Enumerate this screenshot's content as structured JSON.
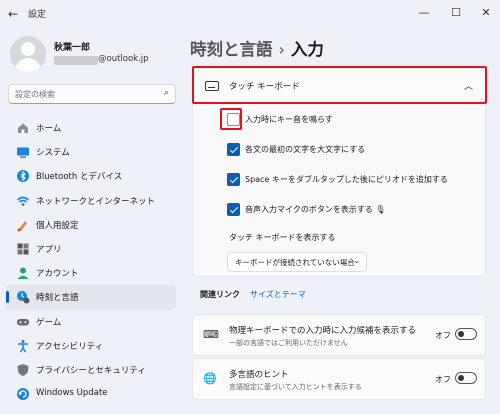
{
  "window": {
    "title": "設定",
    "back_glyph": "←",
    "minimize_glyph": "—",
    "maximize_glyph": "☐",
    "close_glyph": "✕"
  },
  "profile": {
    "name": "秋葉一郎",
    "email_suffix": "@outlook.jp"
  },
  "search": {
    "placeholder": "設定の検索",
    "icon": "search-icon"
  },
  "sidebar": {
    "items": [
      {
        "label": "ホーム",
        "icon": "home-icon",
        "active": false
      },
      {
        "label": "システム",
        "icon": "system-icon",
        "active": false
      },
      {
        "label": "Bluetooth とデバイス",
        "icon": "bluetooth-icon",
        "active": false
      },
      {
        "label": "ネットワークとインターネット",
        "icon": "network-icon",
        "active": false
      },
      {
        "label": "個人用設定",
        "icon": "personalization-icon",
        "active": false
      },
      {
        "label": "アプリ",
        "icon": "apps-icon",
        "active": false
      },
      {
        "label": "アカウント",
        "icon": "account-icon",
        "active": false
      },
      {
        "label": "時刻と言語",
        "icon": "time-language-icon",
        "active": true
      },
      {
        "label": "ゲーム",
        "icon": "gaming-icon",
        "active": false
      },
      {
        "label": "アクセシビリティ",
        "icon": "accessibility-icon",
        "active": false
      },
      {
        "label": "プライバシーとセキュリティ",
        "icon": "privacy-icon",
        "active": false
      },
      {
        "label": "Windows Update",
        "icon": "windows-update-icon",
        "active": false
      }
    ]
  },
  "header": {
    "crumb": "時刻と言語",
    "separator": "›",
    "current": "入力"
  },
  "touch_keyboard": {
    "title": "タッチ キーボード",
    "expand_glyph": "︿",
    "options": [
      {
        "label": "入力時にキー音を鳴らす",
        "checked": false
      },
      {
        "label": "各文の最初の文字を大文字にする",
        "checked": true
      },
      {
        "label": "Space キーをダブルタップした後にピリオドを追加する",
        "checked": true
      },
      {
        "label": "音声入力マイクのボタンを表示する 🎙",
        "checked": true
      }
    ],
    "show_label": "タッチ キーボードを表示する",
    "dropdown_value": "キーボードが接続されていない場合",
    "dropdown_glyph": "⌄"
  },
  "related": {
    "label": "関連リンク",
    "link": "サイズとテーマ"
  },
  "rows": [
    {
      "title": "物理キーボードでの入力時に入力候補を表示する",
      "subtitle": "一部の言語ではご利用いただけません",
      "state": "オフ",
      "icon": "keyboard-icon",
      "on": false
    },
    {
      "title": "多言語のヒント",
      "subtitle": "言語設定に基づいて入力ヒントを表示する",
      "state": "オフ",
      "icon": "multilingual-icon",
      "on": false
    }
  ],
  "colors": {
    "accent": "#0a5fb5",
    "highlight": "#e0141e",
    "background": "#eef1f7"
  }
}
